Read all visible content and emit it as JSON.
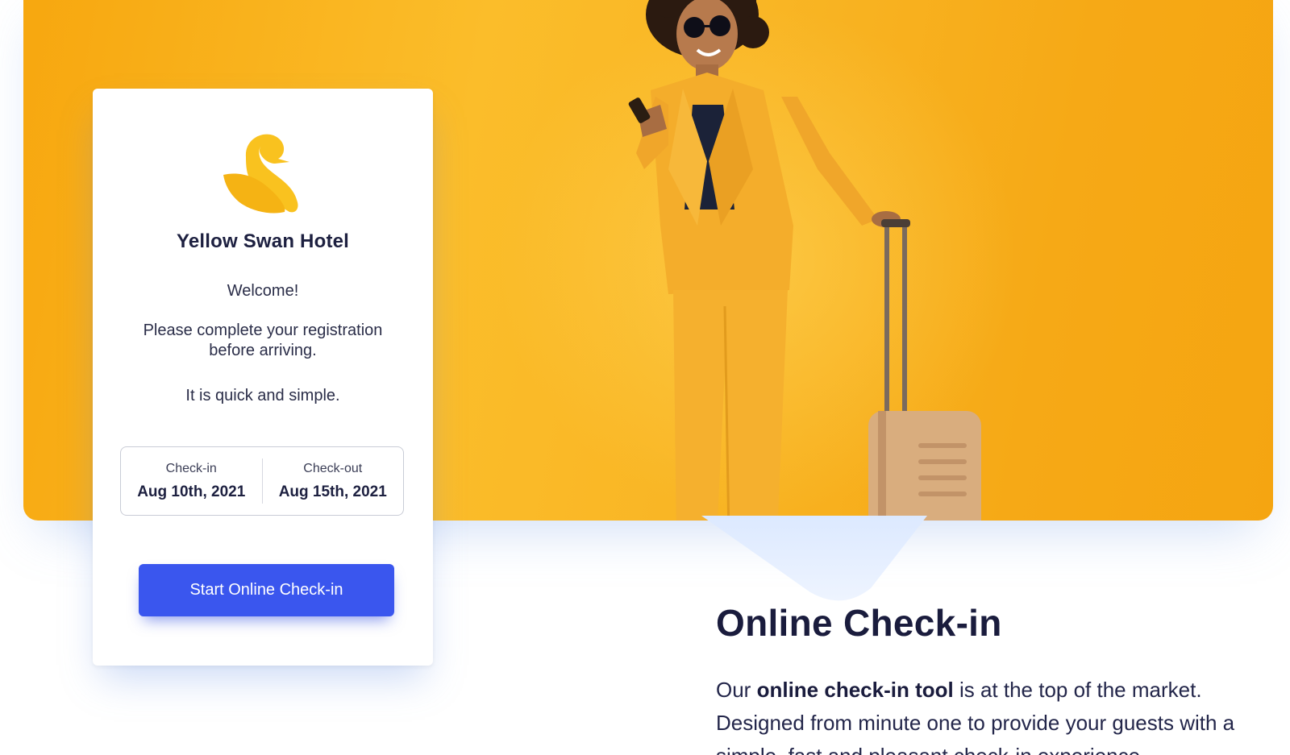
{
  "hotel": {
    "name": "Yellow Swan Hotel",
    "logo_icon": "swan-logo-icon",
    "logo_color": "#f9c21f"
  },
  "card": {
    "welcome": "Welcome!",
    "instructions": "Please complete your registration before arriving.",
    "quick_note": "It is quick and simple.",
    "checkin_label": "Check-in",
    "checkin_date": "Aug 10th, 2021",
    "checkout_label": "Check-out",
    "checkout_date": "Aug 15th, 2021",
    "cta_label": "Start Online Check-in",
    "cta_color": "#3a56ee"
  },
  "hero": {
    "background_color": "#f9b625",
    "image_subject": "woman-with-phone-and-suitcase"
  },
  "section": {
    "title": "Online Check-in",
    "body_prefix": "Our ",
    "body_bold": "online check-in tool",
    "body_suffix": " is at the top of the market. Designed from minute one to provide your guests with a simple, fast and pleasant check-in experience."
  }
}
